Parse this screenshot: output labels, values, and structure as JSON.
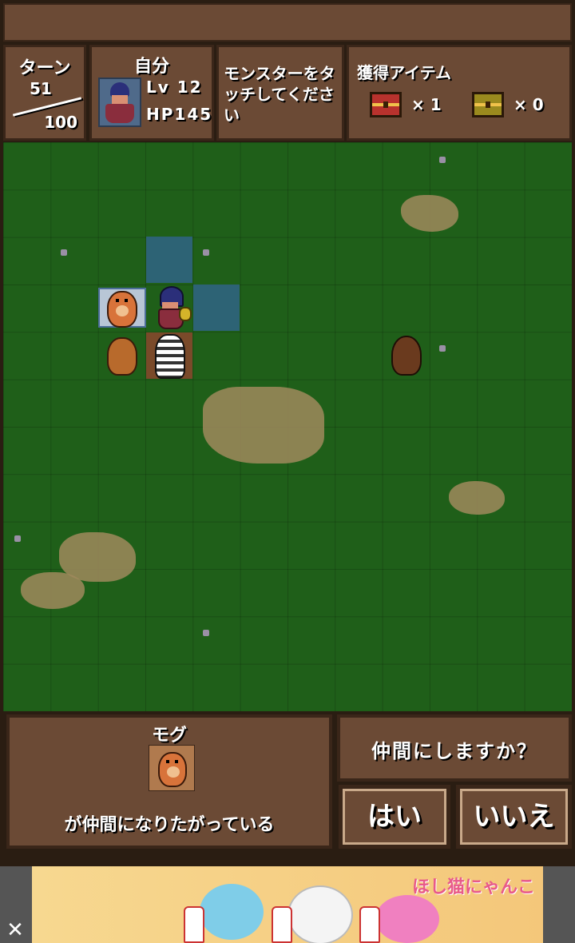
{
  "hud": {
    "turn_label": "ターン",
    "turn_current": "51",
    "turn_max": "100",
    "self_label": "自分",
    "level": "Lv 12",
    "hp": "HP145",
    "message": "モンスターをタッチしてください",
    "items_label": "獲得アイテム",
    "red_chest_count": "× 1",
    "gold_chest_count": "× 0"
  },
  "recruit": {
    "monster_name": "モグ",
    "message": "が仲間になりたがっている",
    "question": "仲間にしますか？",
    "yes_label": "はい",
    "no_label": "いいえ"
  },
  "ad": {
    "logo_text": "ほし猫にゃんこ",
    "close_glyph": "✕"
  },
  "colors": {
    "panel": "#6b4a35",
    "panel_border": "#3a2619",
    "grass": "#1f5f19",
    "move_highlight": "#2f6480"
  }
}
